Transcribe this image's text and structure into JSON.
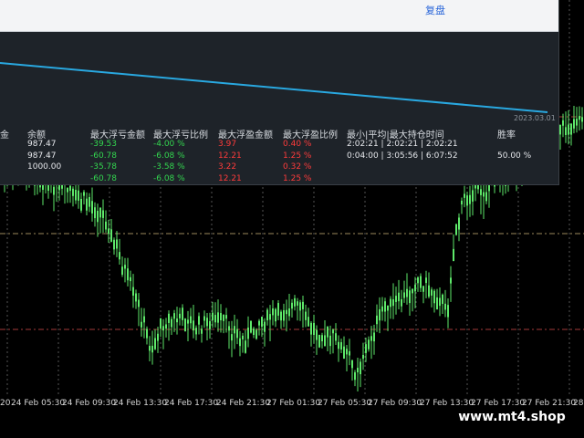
{
  "toolbar": {
    "replay_label": "复盘"
  },
  "equity_curve": {
    "end_date": "2023.03.01"
  },
  "stats_table": {
    "headers": [
      "金",
      "余额",
      "最大浮亏金额",
      "最大浮亏比例",
      "最大浮盈金额",
      "最大浮盈比例",
      "最小|平均|最大持仓时间",
      "胜率"
    ],
    "rows": [
      {
        "balance": "987.47",
        "max_float_loss": "-39.53",
        "max_float_loss_pct": "-4.00 %",
        "max_float_profit": "3.97",
        "max_float_profit_pct": "0.40 %",
        "hold_time": "2:02:21 | 2:02:21 | 2:02:21",
        "win_rate": ""
      },
      {
        "balance": "987.47",
        "max_float_loss": "-60.78",
        "max_float_loss_pct": "-6.08 %",
        "max_float_profit": "12.21",
        "max_float_profit_pct": "1.25 %",
        "hold_time": "0:04:00 | 3:05:56 | 6:07:52",
        "win_rate": "50.00 %"
      },
      {
        "balance": "1000.00",
        "max_float_loss": "-35.78",
        "max_float_loss_pct": "-3.58 %",
        "max_float_profit": "3.22",
        "max_float_profit_pct": "0.32 %",
        "hold_time": "",
        "win_rate": ""
      },
      {
        "balance": "",
        "max_float_loss": "-60.78",
        "max_float_loss_pct": "-6.08 %",
        "max_float_profit": "12.21",
        "max_float_profit_pct": "1.25 %",
        "hold_time": "",
        "win_rate": ""
      }
    ]
  },
  "x_axis_labels": [
    "20",
    "24 Feb 05:30",
    "24 Feb 09:30",
    "24 Feb 13:30",
    "24 Feb 17:30",
    "24 Feb 21:30",
    "27 Feb 01:30",
    "27 Feb 05:30",
    "27 Feb 09:30",
    "27 Feb 13:30",
    "27 Feb 17:30",
    "27 Feb 21:30",
    "28"
  ],
  "watermark": "www.mt4.shop",
  "colors": {
    "candle": "#5ee86a",
    "curve": "#29a8e0",
    "profit": "#33d64f",
    "loss": "#ff3b3b"
  }
}
